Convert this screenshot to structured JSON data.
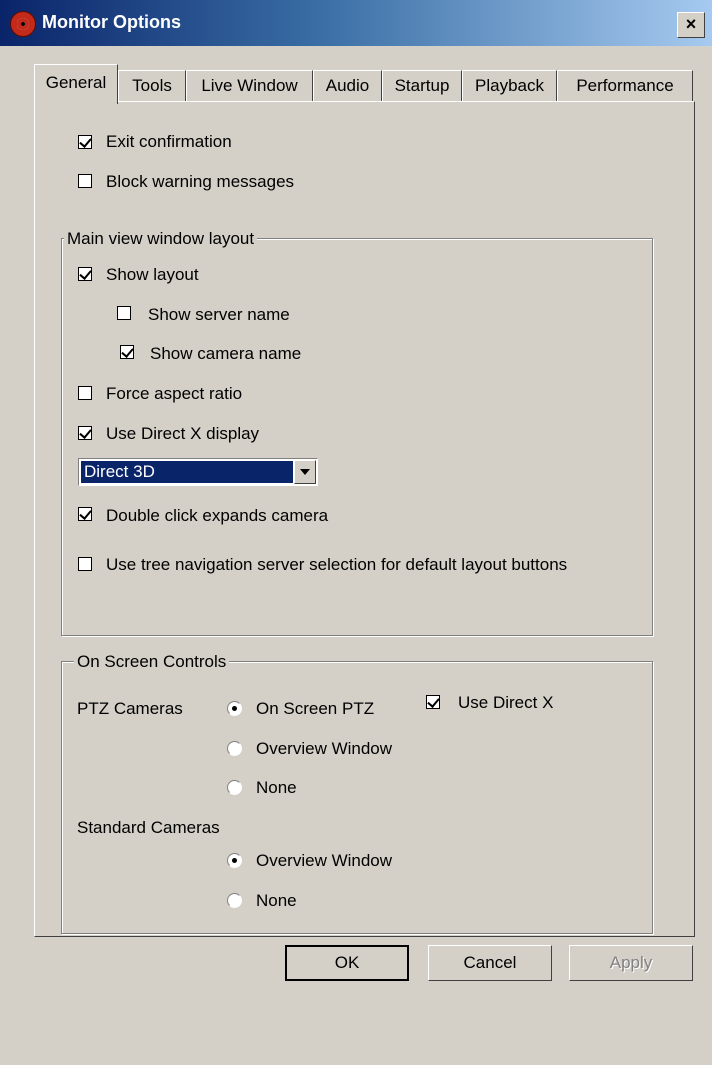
{
  "window": {
    "title": "Monitor Options",
    "close_label": "×"
  },
  "tabs": [
    {
      "label": "General"
    },
    {
      "label": "Tools"
    },
    {
      "label": "Live Window"
    },
    {
      "label": "Audio"
    },
    {
      "label": "Startup"
    },
    {
      "label": "Playback"
    },
    {
      "label": "Performance"
    }
  ],
  "general": {
    "exit_confirmation": {
      "label": "Exit confirmation",
      "checked": true
    },
    "block_warning": {
      "label": "Block warning messages",
      "checked": false
    }
  },
  "main_layout": {
    "title": "Main view window layout",
    "show_layout": {
      "label": "Show layout",
      "checked": true
    },
    "show_server_name": {
      "label": "Show server name",
      "checked": false
    },
    "show_camera_name": {
      "label": "Show camera name",
      "checked": true
    },
    "force_aspect": {
      "label": "Force aspect ratio",
      "checked": false
    },
    "use_directx": {
      "label": "Use Direct X display",
      "checked": true
    },
    "display_mode": "Direct 3D",
    "double_click": {
      "label": "Double click expands camera",
      "checked": true
    },
    "tree_nav": {
      "label": "Use tree navigation server selection for default layout buttons",
      "checked": false
    }
  },
  "on_screen": {
    "title": "On Screen Controls",
    "ptz_label": "PTZ Cameras",
    "ptz_options": [
      "On Screen PTZ",
      "Overview Window",
      "None"
    ],
    "ptz_selected": "On Screen PTZ",
    "use_direct_x": {
      "label": "Use Direct X",
      "checked": true
    },
    "standard_label": "Standard Cameras",
    "standard_options": [
      "Overview Window",
      "None"
    ],
    "standard_selected": "Overview Window"
  },
  "buttons": {
    "ok": "OK",
    "cancel": "Cancel",
    "apply": "Apply"
  },
  "colors": {
    "face": "#d4d0c8",
    "title_start": "#0a246a",
    "title_end": "#a6caf0",
    "selection": "#0a246a"
  }
}
